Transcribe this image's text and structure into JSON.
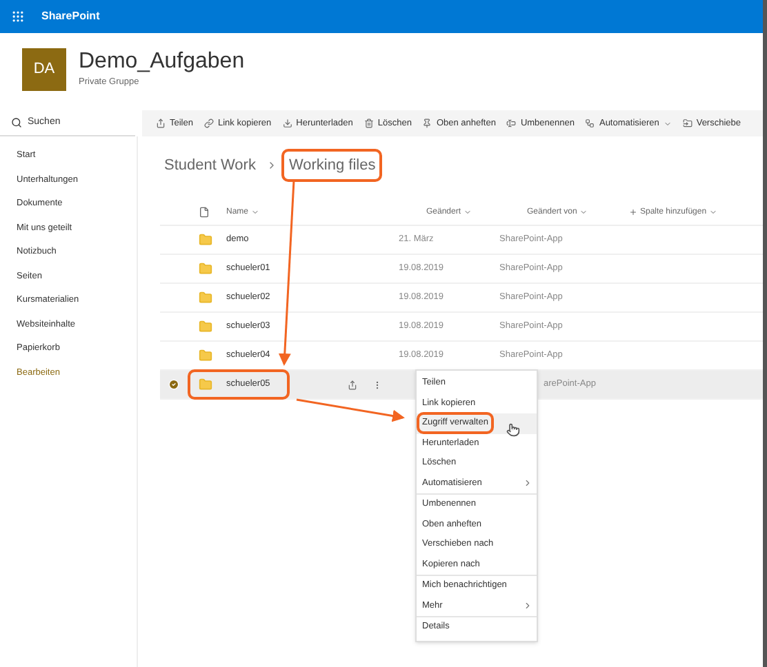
{
  "app_bar": {
    "title": "SharePoint"
  },
  "site": {
    "initials": "DA",
    "name": "Demo_Aufgaben",
    "subtitle": "Private Gruppe"
  },
  "search": {
    "placeholder": "Suchen"
  },
  "toolbar": [
    {
      "label": "Teilen",
      "kind": "button"
    },
    {
      "label": "Link kopieren",
      "kind": "button"
    },
    {
      "label": "Herunterladen",
      "kind": "button"
    },
    {
      "label": "Löschen",
      "kind": "button"
    },
    {
      "label": "Oben anheften",
      "kind": "button"
    },
    {
      "label": "Umbenennen",
      "kind": "button"
    },
    {
      "label": "Automatisieren",
      "kind": "dropdown"
    },
    {
      "label": "Verschiebe",
      "kind": "button"
    }
  ],
  "nav": [
    {
      "label": "Start",
      "kind": "link"
    },
    {
      "label": "Unterhaltungen",
      "kind": "link"
    },
    {
      "label": "Dokumente",
      "kind": "link"
    },
    {
      "label": "Mit uns geteilt",
      "kind": "link"
    },
    {
      "label": "Notizbuch",
      "kind": "link"
    },
    {
      "label": "Seiten",
      "kind": "link"
    },
    {
      "label": "Kursmaterialien",
      "kind": "link"
    },
    {
      "label": "Websiteinhalte",
      "kind": "link"
    },
    {
      "label": "Papierkorb",
      "kind": "link"
    },
    {
      "label": "Bearbeiten",
      "kind": "edit"
    }
  ],
  "breadcrumb": [
    {
      "label": "Student Work",
      "highlighted": false
    },
    {
      "label": "Working files",
      "highlighted": true
    }
  ],
  "table": {
    "columns": [
      {
        "label": "Name",
        "kind": "sort"
      },
      {
        "label": "Geändert",
        "kind": "sort"
      },
      {
        "label": "Geändert von",
        "kind": "sort"
      },
      {
        "label": "Spalte hinzufügen",
        "kind": "add"
      }
    ],
    "rows": [
      {
        "name": "demo",
        "modified": "21. März",
        "modified_by": "SharePoint-App",
        "selected": false,
        "highlighted": false
      },
      {
        "name": "schueler01",
        "modified": "19.08.2019",
        "modified_by": "SharePoint-App",
        "selected": false,
        "highlighted": false
      },
      {
        "name": "schueler02",
        "modified": "19.08.2019",
        "modified_by": "SharePoint-App",
        "selected": false,
        "highlighted": false
      },
      {
        "name": "schueler03",
        "modified": "19.08.2019",
        "modified_by": "SharePoint-App",
        "selected": false,
        "highlighted": false
      },
      {
        "name": "schueler04",
        "modified": "19.08.2019",
        "modified_by": "SharePoint-App",
        "selected": false,
        "highlighted": false
      },
      {
        "name": "schueler05",
        "modified_by": "arePoint-App",
        "selected": true,
        "highlighted": true
      }
    ]
  },
  "context_menu": {
    "groups": [
      [
        {
          "label": "Teilen",
          "submenu": false,
          "selected": false,
          "highlighted": false
        },
        {
          "label": "Link kopieren",
          "submenu": false,
          "selected": false,
          "highlighted": false
        },
        {
          "label": "Zugriff verwalten",
          "submenu": false,
          "selected": true,
          "highlighted": true
        },
        {
          "label": "Herunterladen",
          "submenu": false,
          "selected": false,
          "highlighted": false
        },
        {
          "label": "Löschen",
          "submenu": false,
          "selected": false,
          "highlighted": false
        },
        {
          "label": "Automatisieren",
          "submenu": true,
          "selected": false,
          "highlighted": false
        }
      ],
      [
        {
          "label": "Umbenennen",
          "submenu": false,
          "selected": false,
          "highlighted": false
        },
        {
          "label": "Oben anheften",
          "submenu": false,
          "selected": false,
          "highlighted": false
        },
        {
          "label": "Verschieben nach",
          "submenu": false,
          "selected": false,
          "highlighted": false
        },
        {
          "label": "Kopieren nach",
          "submenu": false,
          "selected": false,
          "highlighted": false
        }
      ],
      [
        {
          "label": "Mich benachrichtigen",
          "submenu": false,
          "selected": false,
          "highlighted": false
        },
        {
          "label": "Mehr",
          "submenu": true,
          "selected": false,
          "highlighted": false
        }
      ],
      [
        {
          "label": "Details",
          "submenu": false,
          "selected": false,
          "highlighted": false
        }
      ]
    ]
  }
}
